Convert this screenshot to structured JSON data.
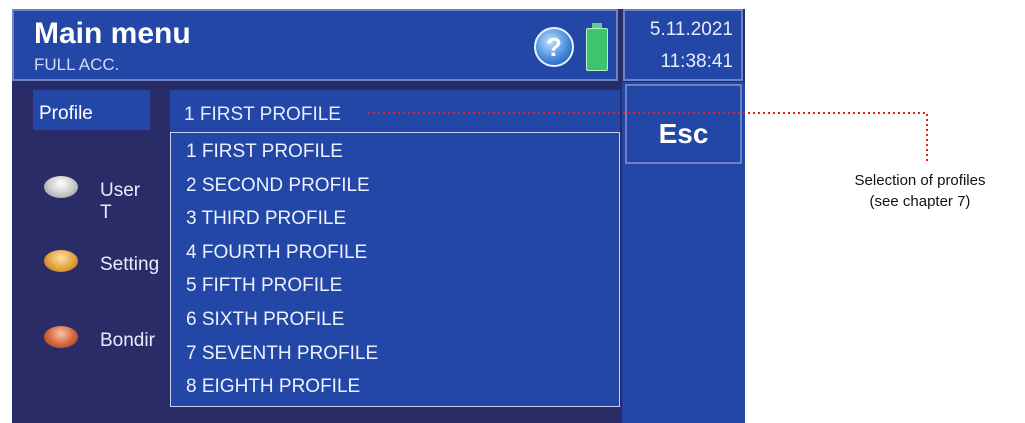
{
  "header": {
    "title": "Main menu",
    "subtitle": "FULL ACC.",
    "help_glyph": "?"
  },
  "status": {
    "date": "5.11.2021",
    "time": "11:38:41",
    "battery_icon": "battery-icon"
  },
  "esc_label": "Esc",
  "profile": {
    "label": "Profile",
    "selected": "1 FIRST PROFILE"
  },
  "menu": [
    {
      "label": "User T",
      "icon": "button-silver-icon",
      "color": "#c8c8c8"
    },
    {
      "label": "Setting",
      "icon": "button-gold-icon",
      "color": "#e0a23c"
    },
    {
      "label": "Bondir",
      "icon": "button-copper-icon",
      "color": "#d2643a"
    }
  ],
  "dropdown": {
    "options": [
      "1 FIRST PROFILE",
      "2 SECOND PROFILE",
      "3 THIRD PROFILE",
      "4 FOURTH PROFILE",
      "5 FIFTH PROFILE",
      "6 SIXTH PROFILE",
      "7 SEVENTH PROFILE",
      "8 EIGHTH PROFILE"
    ]
  },
  "annotation": {
    "line1": "Selection of profiles",
    "line2": "(see chapter 7)",
    "color": "#e22020"
  },
  "colors": {
    "panel": "#2347a6",
    "background": "#2a2c68",
    "border": "#6f82c4"
  }
}
